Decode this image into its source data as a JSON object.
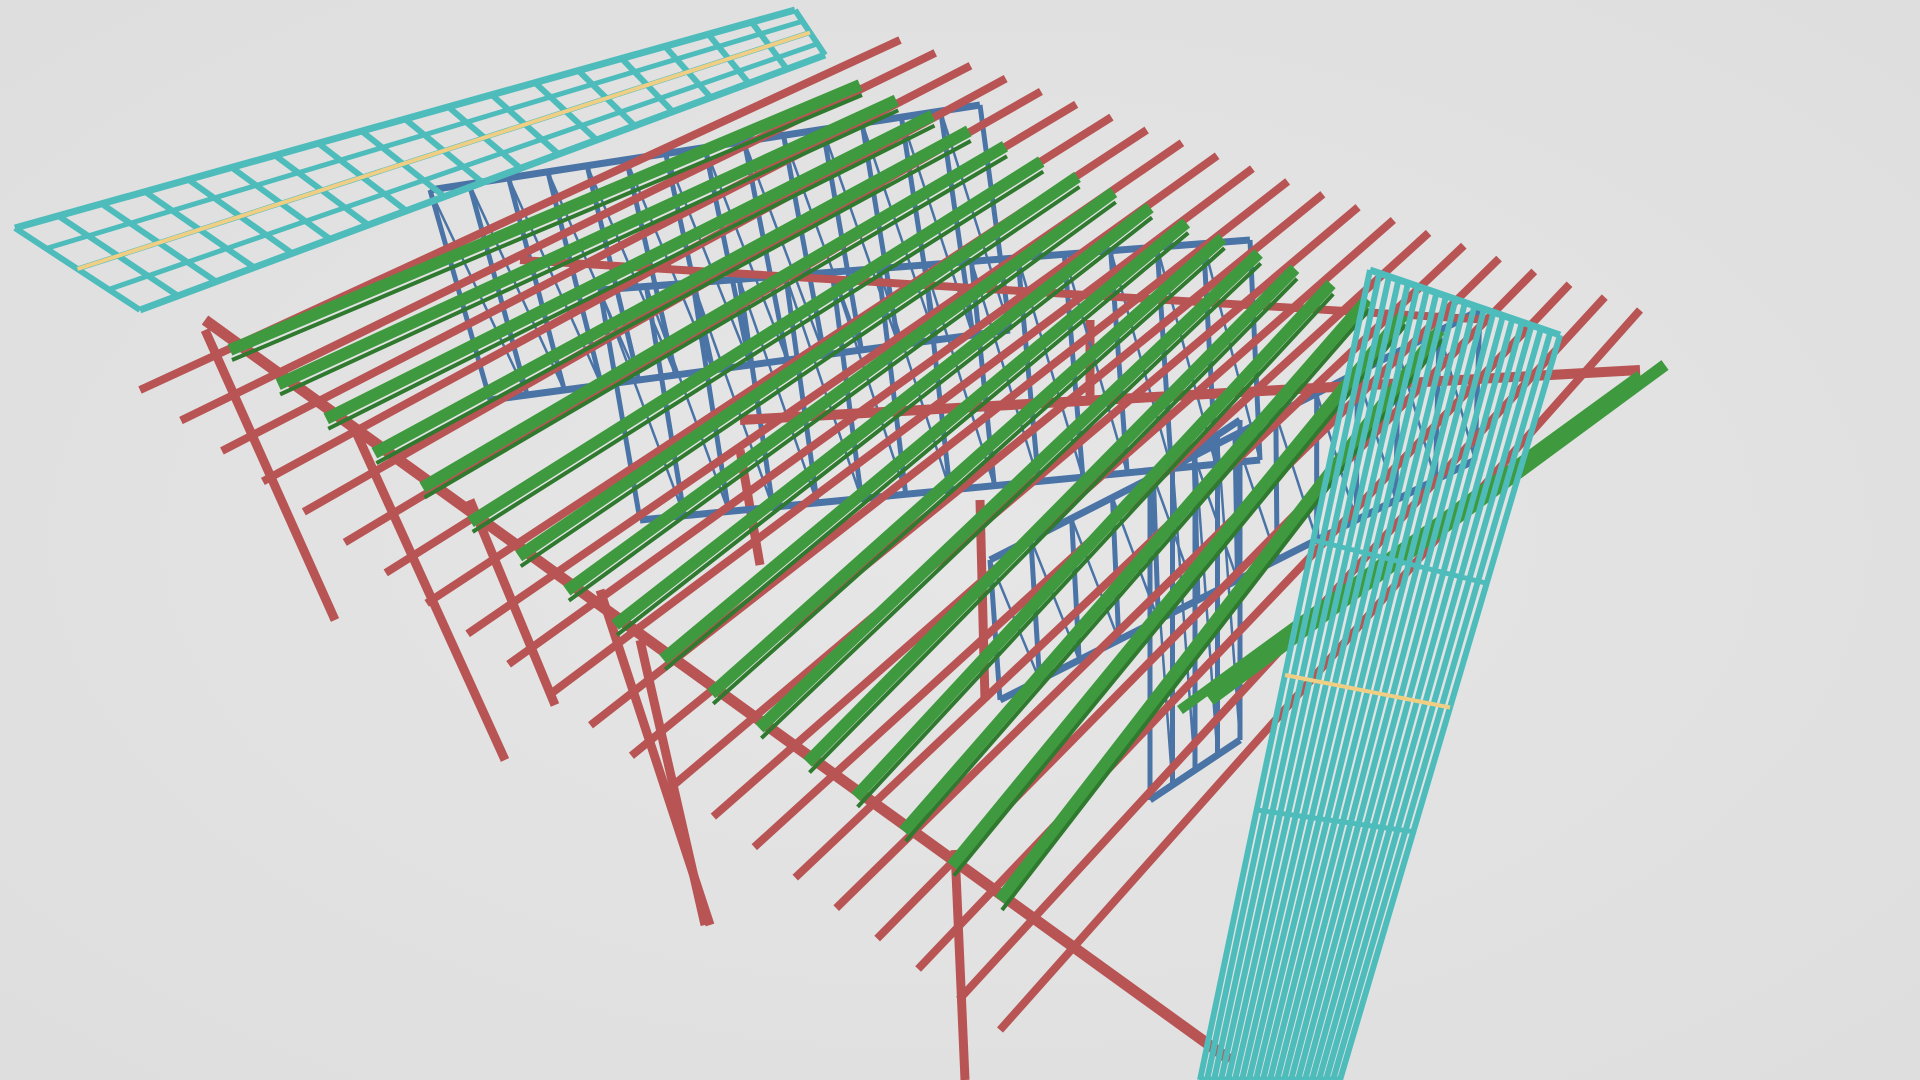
{
  "scene": {
    "description_label": "",
    "colors": {
      "background": "#e2e2e2",
      "column": "#b95454",
      "rafter": "#b95454",
      "purlin_truss": "#3f9a3f",
      "wall_frame": "#4a73a6",
      "ceiling_grid": "#4fbcbc",
      "nogging": "#f0cf85"
    },
    "members": {
      "columns": 9,
      "cantilever_rafters": 22,
      "green_trusses": 17,
      "ceiling_grids": 2
    }
  }
}
